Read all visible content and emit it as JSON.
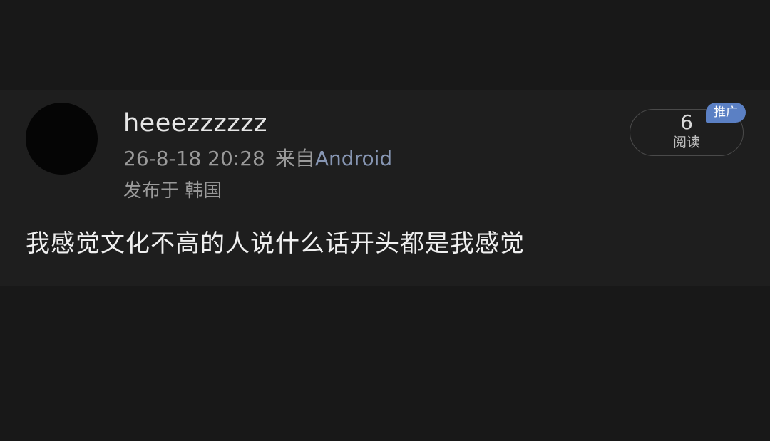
{
  "post": {
    "username": "heeezzzzzz",
    "timestamp": "26-8-18 20:28",
    "source_prefix": "来自",
    "source_app": "Android",
    "location": "发布于 韩国",
    "content": "我感觉文化不高的人说什么话开头都是我感觉",
    "read_count": "6",
    "read_label": "阅读",
    "promo_badge": "推广"
  },
  "colors": {
    "background": "#181818",
    "card": "#1e1e1e",
    "accent_link": "#8796b3",
    "badge": "#5b80c4"
  }
}
